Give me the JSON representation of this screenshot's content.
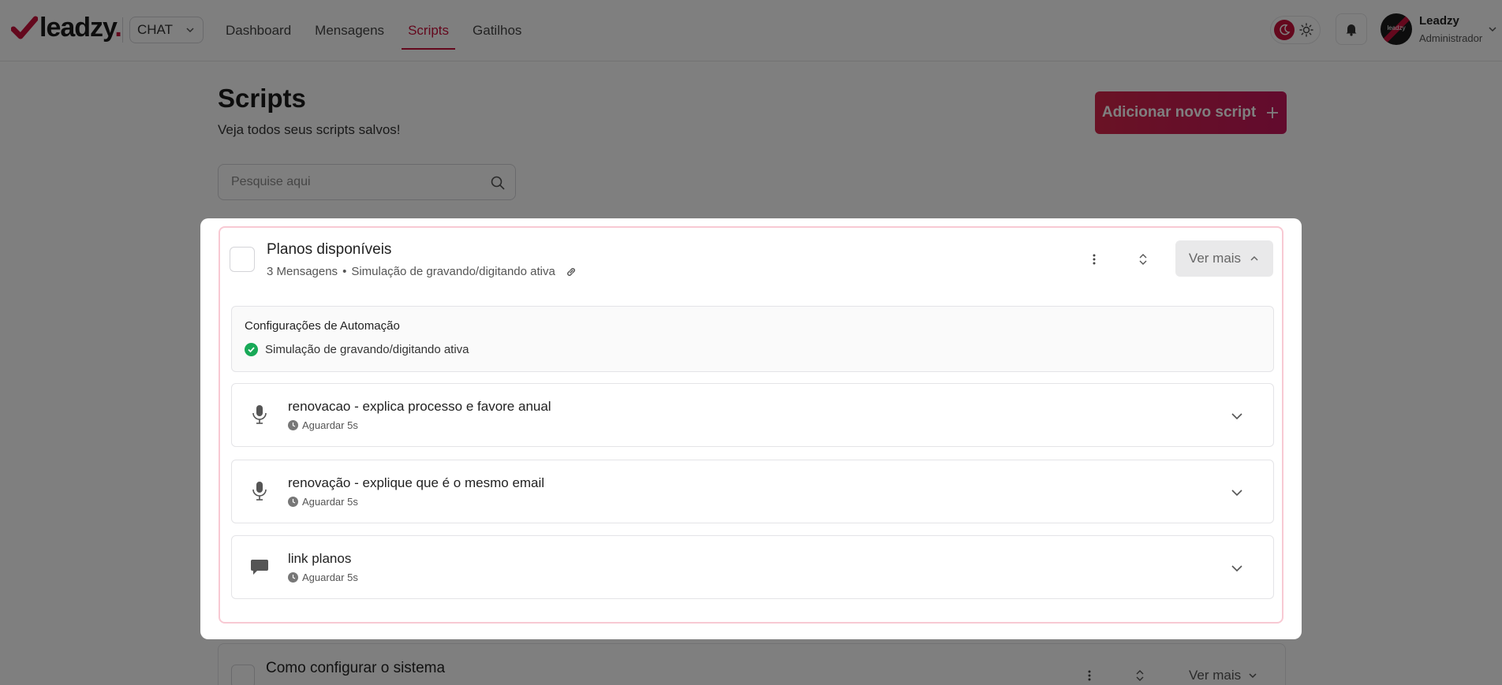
{
  "brand": {
    "name": "leadzy",
    "dot": ".",
    "accent": "#c8103b"
  },
  "header": {
    "mode_select": "CHAT",
    "nav": [
      {
        "label": "Dashboard",
        "active": false
      },
      {
        "label": "Mensagens",
        "active": false
      },
      {
        "label": "Scripts",
        "active": true
      },
      {
        "label": "Gatilhos",
        "active": false
      }
    ],
    "user": {
      "name": "Leadzy",
      "role": "Administrador",
      "avatar_text": "leadzy"
    }
  },
  "page": {
    "title": "Scripts",
    "subtitle": "Veja todos seus scripts salvos!",
    "add_button": "Adicionar novo script",
    "search_placeholder": "Pesquise aqui"
  },
  "scripts": [
    {
      "title": "Planos disponíveis",
      "message_count": "3 Mensagens",
      "separator": "•",
      "simulation": "Simulação de gravando/digitando ativa",
      "toggle_label": "Ver mais",
      "automation": {
        "title": "Configurações de Automação",
        "items": [
          "Simulação de gravando/digitando ativa"
        ]
      },
      "messages": [
        {
          "type": "audio",
          "icon": "microphone-icon",
          "title": "renovacao - explica processo e favore anual",
          "wait": "Aguardar 5s"
        },
        {
          "type": "audio",
          "icon": "microphone-icon",
          "title": "renovação - explique que é o mesmo email",
          "wait": "Aguardar 5s"
        },
        {
          "type": "text",
          "icon": "chat-bubble-icon",
          "title": "link planos",
          "wait": "Aguardar 5s"
        }
      ]
    },
    {
      "title": "Como configurar o sistema",
      "toggle_label": "Ver mais"
    }
  ]
}
